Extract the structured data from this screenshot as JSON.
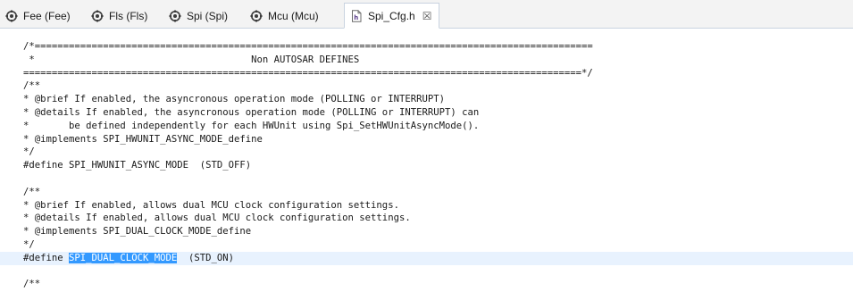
{
  "tabs": [
    {
      "label": "Fee (Fee)",
      "icon": "gear-config-icon",
      "active": false
    },
    {
      "label": "Fls (Fls)",
      "icon": "gear-config-icon",
      "active": false
    },
    {
      "label": "Spi (Spi)",
      "icon": "gear-config-icon",
      "active": false
    },
    {
      "label": "Mcu (Mcu)",
      "icon": "gear-config-icon",
      "active": false
    },
    {
      "label": "Spi_Cfg.h",
      "icon": "header-file-icon",
      "active": true,
      "close": "☒"
    }
  ],
  "code": {
    "lines": [
      "/*==================================================================================================",
      " *                                      Non AUTOSAR DEFINES",
      "==================================================================================================*/",
      "/**",
      "* @brief If enabled, the asyncronous operation mode (POLLING or INTERRUPT)",
      "* @details If enabled, the asyncronous operation mode (POLLING or INTERRUPT) can",
      "*       be defined independently for each HWUnit using Spi_SetHWUnitAsyncMode().",
      "* @implements SPI_HWUNIT_ASYNC_MODE_define",
      "*/",
      "#define SPI_HWUNIT_ASYNC_MODE  (STD_OFF)",
      "",
      "/**",
      "* @brief If enabled, allows dual MCU clock configuration settings.",
      "* @details If enabled, allows dual MCU clock configuration settings.",
      "* @implements SPI_DUAL_CLOCK_MODE_define",
      "*/",
      "#define ",
      "",
      "/**"
    ],
    "current_line": {
      "prefix": "#define ",
      "selected": "SPI_DUAL_CLOCK_MODE",
      "suffix": "  (STD_ON)"
    }
  },
  "colors": {
    "tabbar_bg": "#f3f3f3",
    "current_line_bg": "#e8f2fe",
    "selection_bg": "#3399ff"
  }
}
